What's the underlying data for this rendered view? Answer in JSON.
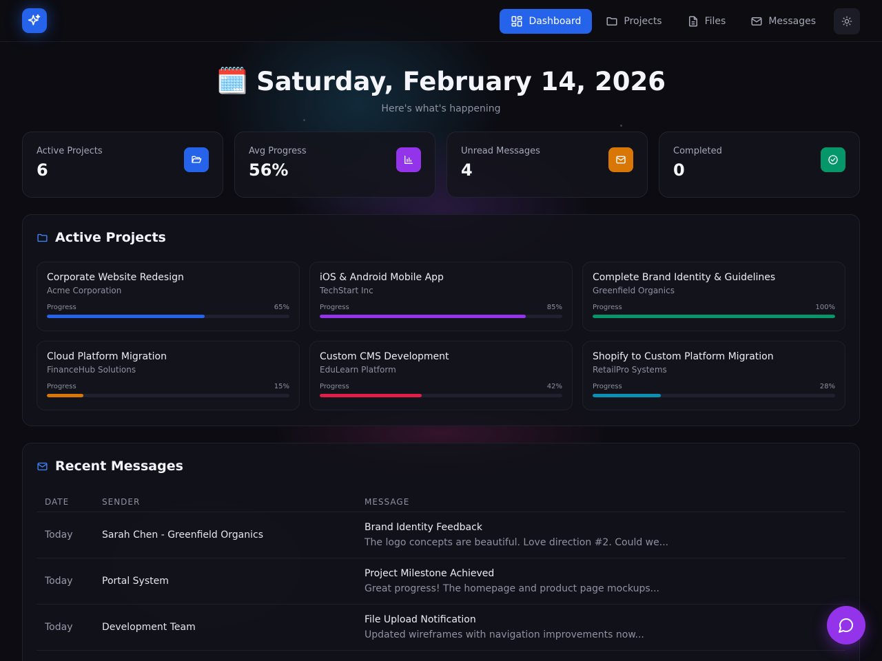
{
  "nav": {
    "items": [
      {
        "label": "Dashboard",
        "icon": "dashboard-icon",
        "active": true
      },
      {
        "label": "Projects",
        "icon": "folder-icon",
        "active": false
      },
      {
        "label": "Files",
        "icon": "file-icon",
        "active": false
      },
      {
        "label": "Messages",
        "icon": "mail-icon",
        "active": false
      }
    ]
  },
  "hero": {
    "emoji": "🗓️",
    "date": "Saturday, February 14, 2026",
    "subtitle": "Here's what's happening"
  },
  "stats": [
    {
      "label": "Active Projects",
      "value": "6",
      "icon": "folder-open-icon",
      "color": "#2563eb"
    },
    {
      "label": "Avg Progress",
      "value": "56%",
      "icon": "chart-icon",
      "color": "#9333ea"
    },
    {
      "label": "Unread Messages",
      "value": "4",
      "icon": "mail-icon",
      "color": "#d97706"
    },
    {
      "label": "Completed",
      "value": "0",
      "icon": "check-circle-icon",
      "color": "#059669"
    }
  ],
  "projects": {
    "title": "Active Projects",
    "progress_label": "Progress",
    "items": [
      {
        "name": "Corporate Website Redesign",
        "client": "Acme Corporation",
        "progress": 65,
        "progress_text": "65%",
        "color": "#2563eb"
      },
      {
        "name": "iOS & Android Mobile App",
        "client": "TechStart Inc",
        "progress": 85,
        "progress_text": "85%",
        "color": "#9333ea"
      },
      {
        "name": "Complete Brand Identity & Guidelines",
        "client": "Greenfield Organics",
        "progress": 100,
        "progress_text": "100%",
        "color": "#059669"
      },
      {
        "name": "Cloud Platform Migration",
        "client": "FinanceHub Solutions",
        "progress": 15,
        "progress_text": "15%",
        "color": "#d97706"
      },
      {
        "name": "Custom CMS Development",
        "client": "EduLearn Platform",
        "progress": 42,
        "progress_text": "42%",
        "color": "#e11d48"
      },
      {
        "name": "Shopify to Custom Platform Migration",
        "client": "RetailPro Systems",
        "progress": 28,
        "progress_text": "28%",
        "color": "#0891b2"
      }
    ]
  },
  "messages": {
    "title": "Recent Messages",
    "columns": {
      "date": "DATE",
      "sender": "SENDER",
      "message": "MESSAGE"
    },
    "rows": [
      {
        "date": "Today",
        "sender": "Sarah Chen - Greenfield Organics",
        "subject": "Brand Identity Feedback",
        "preview": "The logo concepts are beautiful. Love direction #2. Could we..."
      },
      {
        "date": "Today",
        "sender": "Portal System",
        "subject": "Project Milestone Achieved",
        "preview": "Great progress! The homepage and product page mockups..."
      },
      {
        "date": "Today",
        "sender": "Development Team",
        "subject": "File Upload Notification",
        "preview": "Updated wireframes with navigation improvements now..."
      }
    ]
  }
}
